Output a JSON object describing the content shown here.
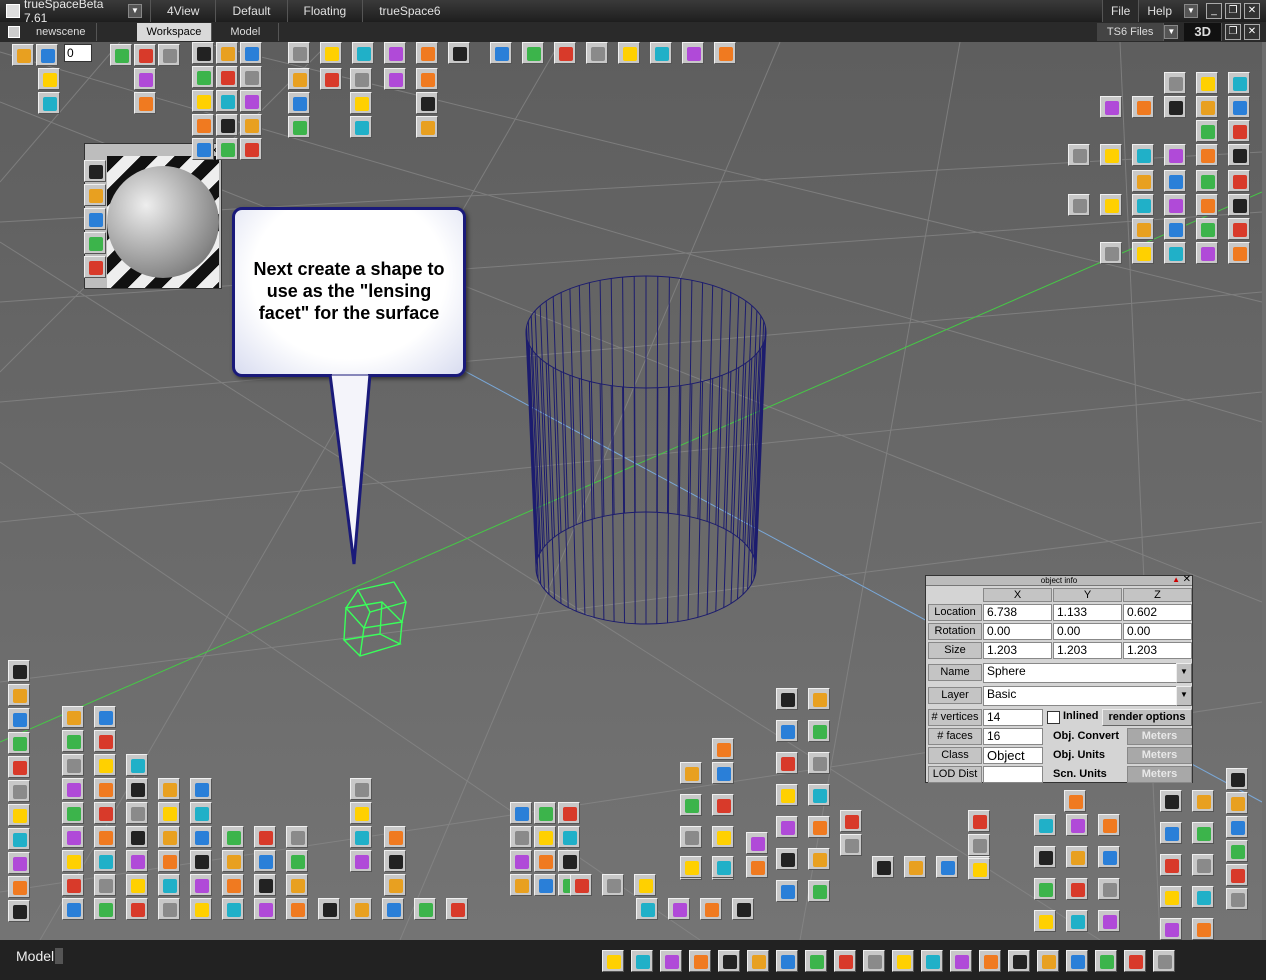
{
  "app": {
    "title": "trueSpaceBeta 7.61",
    "menu_tabs": [
      "4View",
      "Default",
      "Floating",
      "trueSpace6"
    ],
    "file_menu": "File",
    "help_menu": "Help"
  },
  "tabs": {
    "scene": "newscene",
    "workspace": "Workspace",
    "model": "Model",
    "files": "TS6 Files",
    "view_mode": "3D"
  },
  "toolbar": {
    "frame_value": "0"
  },
  "callout": {
    "text": "Next create a shape to use as the \"lensing facet\" for the surface"
  },
  "object_info": {
    "title": "object info",
    "columns": [
      "X",
      "Y",
      "Z"
    ],
    "location_label": "Location",
    "location": [
      "6.738",
      "1.133",
      "0.602"
    ],
    "rotation_label": "Rotation",
    "rotation": [
      "0.00",
      "0.00",
      "0.00"
    ],
    "size_label": "Size",
    "size": [
      "1.203",
      "1.203",
      "1.203"
    ],
    "name_label": "Name",
    "name": "Sphere",
    "layer_label": "Layer",
    "layer": "Basic",
    "vertices_label": "# vertices",
    "vertices": "14",
    "faces_label": "# faces",
    "faces": "16",
    "class_label": "Class",
    "class": "Object",
    "lod_label": "LOD Dist",
    "lod": "",
    "inlined_label": "Inlined",
    "render_options": "render options",
    "obj_convert": "Obj. Convert",
    "obj_units": "Obj. Units",
    "scn_units": "Scn. Units",
    "meters": "Meters"
  },
  "status": {
    "mode": "Model"
  },
  "colors": {
    "accent_blue": "#1a1a7a",
    "wire_cylinder": "#1c1c6e",
    "wire_shape": "#39ff5a",
    "axis_green": "#46c846",
    "axis_blue": "#7aa8d8"
  }
}
